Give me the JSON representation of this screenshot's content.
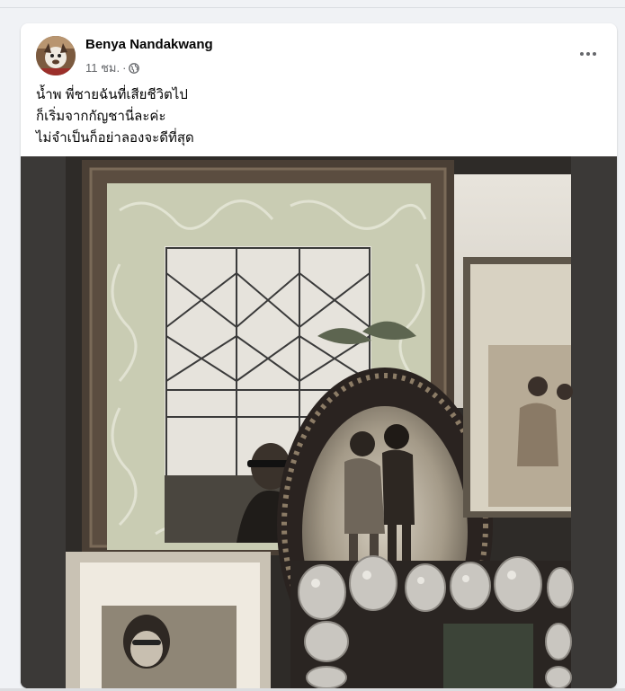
{
  "post": {
    "author": "Benya Nandakwang",
    "time": "11 ชม.",
    "separator": "·",
    "privacy_icon": "globe-icon",
    "more_icon": "more-options-icon",
    "text_lines": [
      "น้ำพ พี่ชายฉันที่เสียชีวิตไป",
      "ก็เริ่มจากกัญชานี่ละค่ะ",
      "ไม่จำเป็นก็อย่าลองจะดีที่สุด"
    ]
  },
  "colors": {
    "author": "#050505",
    "meta": "#65676b",
    "card": "#ffffff",
    "page_bg": "#f0f2f5"
  }
}
